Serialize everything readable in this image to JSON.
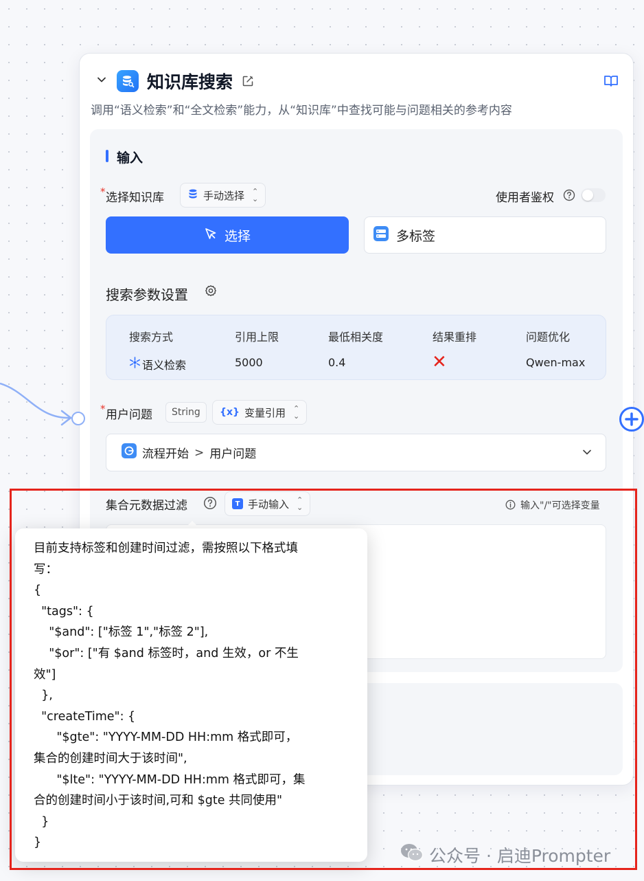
{
  "node": {
    "title": "知识库搜索",
    "description": "调用“语义检索”和“全文检索”能力，从“知识库”中查找可能与问题相关的参考内容"
  },
  "input_section": {
    "title": "输入",
    "knowledge_base": {
      "required_mark": "*",
      "label": "选择知识库",
      "mode_select": "手动选择",
      "auth_label": "使用者鉴权",
      "select_button": "选择",
      "multi_tag_button": "多标签"
    },
    "search_params": {
      "title": "搜索参数设置",
      "headers": [
        "搜索方式",
        "引用上限",
        "最低相关度",
        "结果重排",
        "问题优化"
      ],
      "values": {
        "method": "语义检索",
        "limit": "5000",
        "min_relevance": "0.4",
        "rerank": "✕",
        "optimize": "Qwen-max"
      }
    },
    "user_question": {
      "required_mark": "*",
      "label": "用户问题",
      "type_badge": "String",
      "mode_select": "变量引用",
      "value_source": "流程开始",
      "value_separator": ">",
      "value_field": "用户问题"
    },
    "metadata_filter": {
      "label": "集合元数据过滤",
      "mode_select": "手动输入",
      "hint": "输入\"/\"可选择变量"
    }
  },
  "tooltip": {
    "lines": [
      "目前支持标签和创建时间过滤，需按照以下格式填",
      "写：",
      "{",
      "  \"tags\": {",
      "    \"$and\": [\"标签 1\",\"标签 2\"],",
      "    \"$or\": [\"有 $and 标签时，and 生效，or 不生",
      "效\"]",
      "  },",
      "  \"createTime\": {",
      "      \"$gte\": \"YYYY-MM-DD HH:mm 格式即可，",
      "集合的创建时间大于该时间\",",
      "      \"$lte\": \"YYYY-MM-DD HH:mm 格式即可，集",
      "合的创建时间小于该时间,可和 $gte 共同使用\"",
      "  }",
      "}"
    ]
  },
  "watermark": {
    "text": "公众号 · 启迪Prompter"
  },
  "colors": {
    "primary": "#3370ff",
    "highlight_frame": "#e5241c",
    "rerank_off": "#e5241c"
  }
}
